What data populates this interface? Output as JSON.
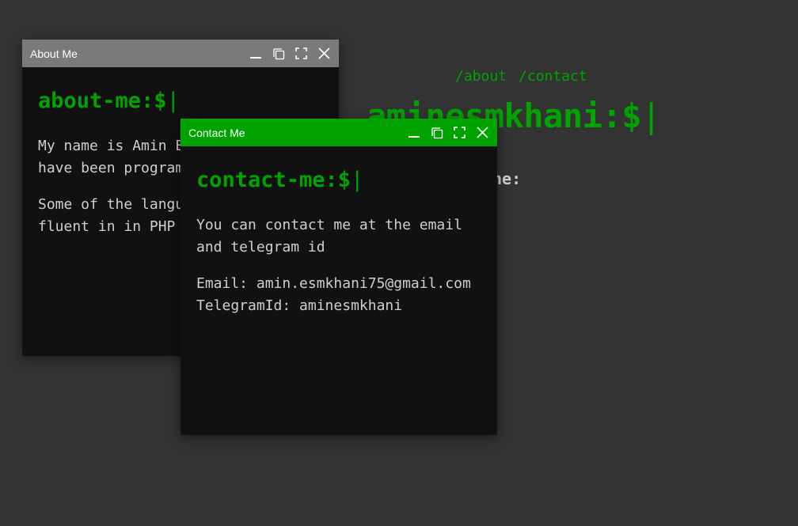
{
  "nav": {
    "links": [
      "/about",
      "/contact"
    ]
  },
  "hero": {
    "title": "aminesmkhani:$",
    "cursor": "|",
    "subtitle_visible": "ne:"
  },
  "about_window": {
    "title": "About Me",
    "heading": "about-me:$",
    "cursor": "|",
    "paragraphs": [
      "My name is Amin E\nhave been program",
      "Some of the langu\nfluent in in PHP"
    ],
    "titlebar_color": "#7a7a7a"
  },
  "contact_window": {
    "title": "Contact Me",
    "heading": "contact-me:$",
    "cursor": "|",
    "paragraphs": [
      "You can contact me at the email\nand telegram id",
      "Email: amin.esmkhani75@gmail.com\nTelegramId: aminesmkhani"
    ],
    "titlebar_color": "#00a300"
  },
  "window_controls": [
    "minimize-icon",
    "restore-icon",
    "maximize-icon",
    "close-icon"
  ],
  "colors": {
    "accent": "#00a300",
    "background": "#333333",
    "window_bg": "#111111"
  }
}
